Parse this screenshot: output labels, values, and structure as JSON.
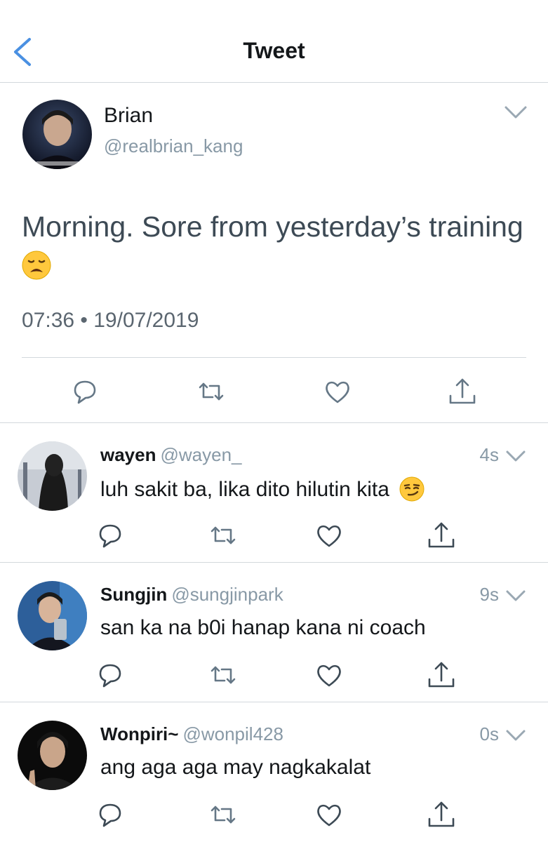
{
  "header": {
    "title": "Tweet",
    "back_icon": "chevron-left-icon"
  },
  "colors": {
    "accent": "#4a90e2",
    "muted": "#8899a6",
    "text": "#14171a",
    "divider": "#d3d8dc"
  },
  "main_tweet": {
    "name": "Brian",
    "handle": "@realbrian_kang",
    "text": "Morning. Sore from yesterday’s training",
    "emoji": "weary-face",
    "meta": "07:36 • 19/07/2019",
    "actions": [
      "reply-icon",
      "retweet-icon",
      "like-icon",
      "share-icon"
    ]
  },
  "replies": [
    {
      "name": "wayen",
      "handle": "@wayen_",
      "time": "4s",
      "text": "luh sakit ba, lika dito hilutin kita",
      "emoji": "smirking-face"
    },
    {
      "name": "Sungjin",
      "handle": "@sungjinpark",
      "time": "9s",
      "text": "san ka na b0i hanap kana ni coach"
    },
    {
      "name": "Wonpiri~",
      "handle": "@wonpil428",
      "time": "0s",
      "text": "ang aga aga may nagkakalat"
    }
  ]
}
